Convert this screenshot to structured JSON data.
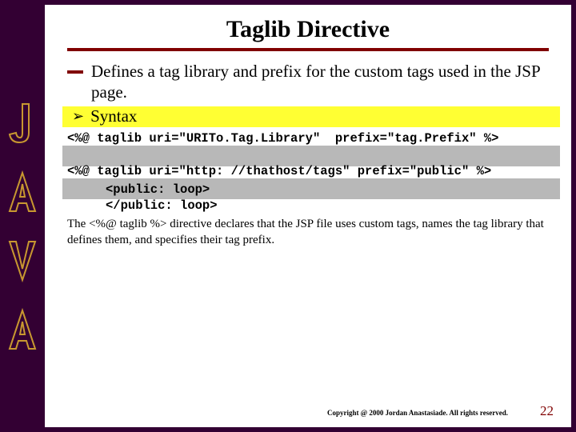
{
  "title": "Taglib Directive",
  "bullet_main": "Defines a tag library and prefix for the custom tags used in the JSP page.",
  "syntax_label": "Syntax",
  "code_line_1": "<%@ taglib uri=\"URITo.Tag.Library\"  prefix=\"tag.Prefix\" %>",
  "code_line_2": "<%@ taglib uri=\"http: //thathost/tags\" prefix=\"public\" %>",
  "code_tag_open": "<public: loop>",
  "code_tag_close": "</public: loop>",
  "explain_text": "The <%@ taglib %> directive declares that the JSP file uses custom tags, names the tag library that defines them, and specifies their tag prefix.",
  "copyright": "Copyright @ 2000 Jordan Anastasiade. All rights reserved.",
  "page_number": "22",
  "java_letters": [
    "J",
    "A",
    "V",
    "A"
  ]
}
